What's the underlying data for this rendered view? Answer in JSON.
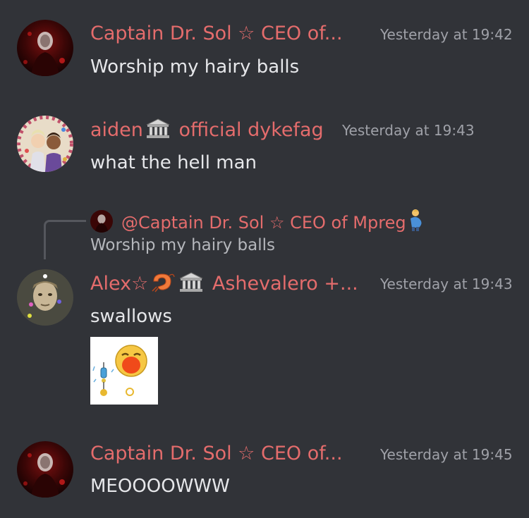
{
  "messages": [
    {
      "username": "Captain Dr. Sol ☆ CEO of...",
      "timestamp": "Yesterday at 19:42",
      "text": "Worship my hairy balls",
      "avatar_icon": "dark-red-portrait-avatar"
    },
    {
      "username_part1": "aiden",
      "username_part2": " official dykefag",
      "username_emoji": "classical-building-emoji",
      "timestamp": "Yesterday at 19:43",
      "text": "what the hell man",
      "avatar_icon": "anime-couple-avatar"
    },
    {
      "reply": {
        "mention": "@Captain Dr. Sol ☆ CEO of Mpreg",
        "mention_emoji": "pregnant-man-emoji",
        "text": "Worship my hairy balls"
      },
      "username_part1": "Alex☆",
      "username_part2": " Ashevalero +...",
      "username_emojis": [
        "shrimp-emoji",
        "classical-building-emoji"
      ],
      "timestamp": "Yesterday at 19:43",
      "text": "swallows",
      "avatar_icon": "sepia-face-avatar",
      "sticker_icon": "screaming-emoji-sticker"
    },
    {
      "username": "Captain Dr. Sol ☆ CEO of...",
      "timestamp": "Yesterday at 19:45",
      "text": "MEOOOOWWW",
      "avatar_icon": "dark-red-portrait-avatar"
    }
  ],
  "colors": {
    "background": "#313338",
    "username": "#e46c6c",
    "timestamp": "#9fa1a8",
    "text": "#e6e7ea",
    "reply_text": "#b5b7bc"
  }
}
